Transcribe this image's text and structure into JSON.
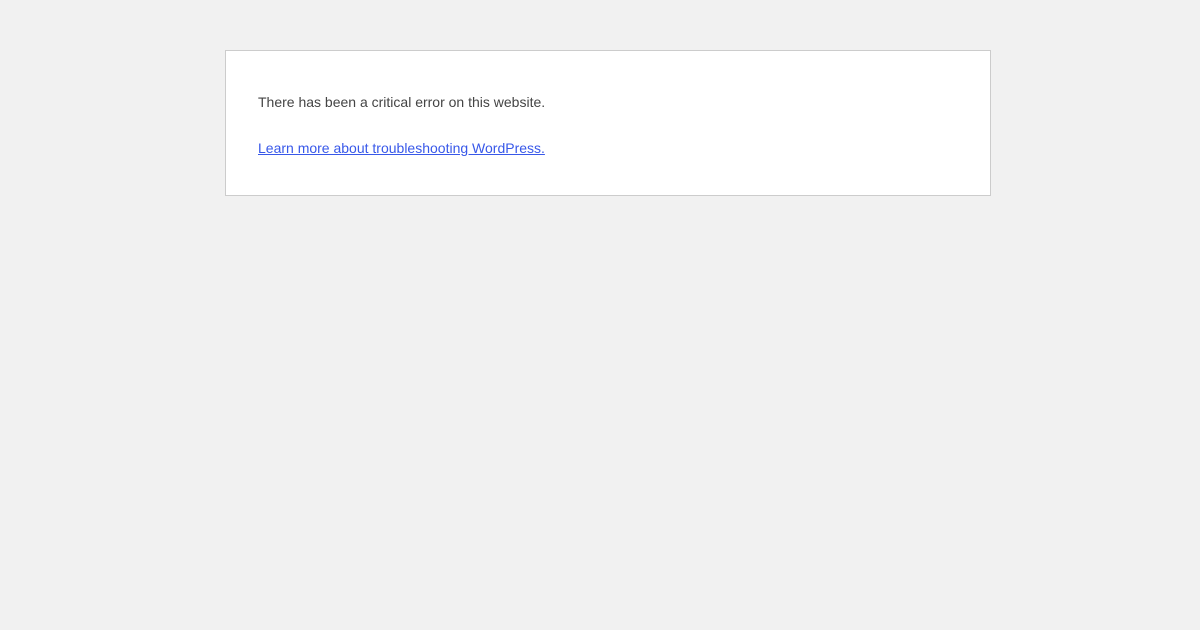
{
  "error_box": {
    "message": "There has been a critical error on this website.",
    "link_label": "Learn more about troubleshooting WordPress."
  },
  "colors": {
    "background": "#f1f1f1",
    "panel": "#ffffff",
    "text": "#444444",
    "link": "#3858e9",
    "border": "#cccccc"
  }
}
